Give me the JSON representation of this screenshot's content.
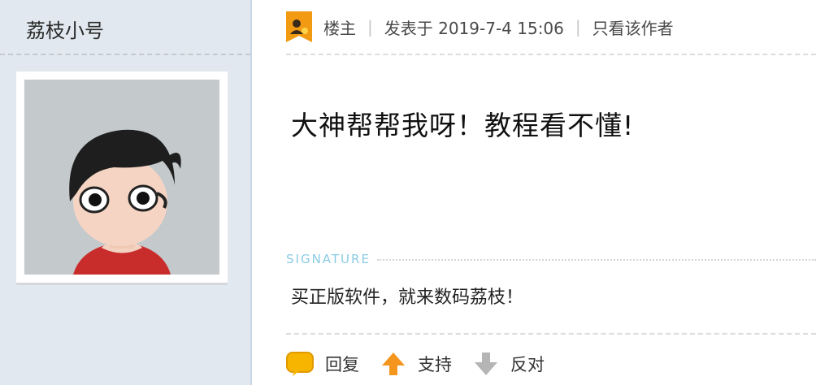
{
  "user": {
    "name": "荔枝小号",
    "avatar_icon": "cartoon-boy-avatar"
  },
  "post": {
    "role_badge_icon": "louzhu-badge-icon",
    "role": "楼主",
    "posted_label": "发表于 2019-7-4 15:06",
    "only_author": "只看该作者",
    "content": "大神帮帮我呀！教程看不懂!",
    "signature_label": "SIGNATURE",
    "signature_text": "买正版软件，就来数码荔枝！"
  },
  "actions": [
    {
      "icon": "reply-bubble-icon",
      "label": "回复"
    },
    {
      "icon": "arrow-up-icon",
      "label": "支持"
    },
    {
      "icon": "arrow-down-icon",
      "label": "反对"
    }
  ],
  "colors": {
    "sidebar_bg": "#e1e8ef",
    "signature_accent": "#8bcbe5",
    "support_orange": "#f4961e"
  }
}
